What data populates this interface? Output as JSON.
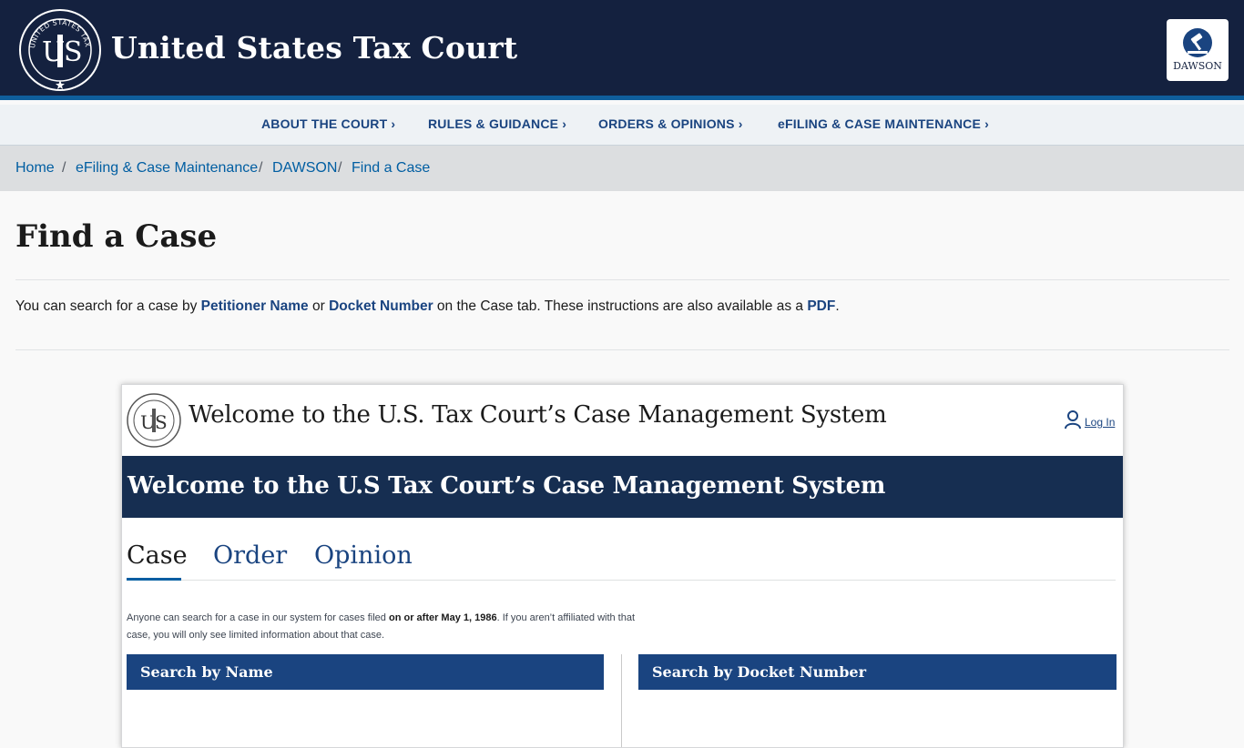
{
  "header": {
    "site_title": "United States Tax Court",
    "seal_text": "UNITED STATES TAX COURT",
    "dawson_label": "DAWSON"
  },
  "nav": {
    "items": [
      {
        "label": "ABOUT THE COURT ›"
      },
      {
        "label": "RULES & GUIDANCE ›"
      },
      {
        "label": "ORDERS & OPINIONS ›"
      },
      {
        "label": "eFILING & CASE MAINTENANCE ›"
      }
    ]
  },
  "breadcrumb": {
    "items": [
      "Home",
      "eFiling & Case Maintenance",
      "DAWSON",
      "Find a Case"
    ],
    "separator": "/"
  },
  "page": {
    "title": "Find a Case",
    "intro_before": "You can search for a case by ",
    "link_petitioner": "Petitioner Name",
    "intro_or": " or ",
    "link_docket": "Docket Number",
    "intro_after": " on the Case tab. These instructions are also available as a ",
    "link_pdf": "PDF",
    "intro_end": "."
  },
  "screenshot": {
    "welcome_title": "Welcome to the U.S. Tax Court’s Case Management System",
    "login_label": "Log In",
    "banner_title": "Welcome to the U.S Tax Court’s Case Management System",
    "tabs": [
      "Case",
      "Order",
      "Opinion"
    ],
    "note_before": "Anyone can search for a case in our system for cases filed ",
    "note_bold": "on or after May 1, 1986",
    "note_after": ". If you aren’t affiliated with that case, you will only see limited information about that case.",
    "panel_name": "Search by Name",
    "panel_docket": "Search by Docket Number"
  },
  "colors": {
    "header_bg": "#14213f",
    "accent_blue": "#1a4480",
    "link_blue": "#005ea2",
    "banner_bg": "#162e51"
  }
}
